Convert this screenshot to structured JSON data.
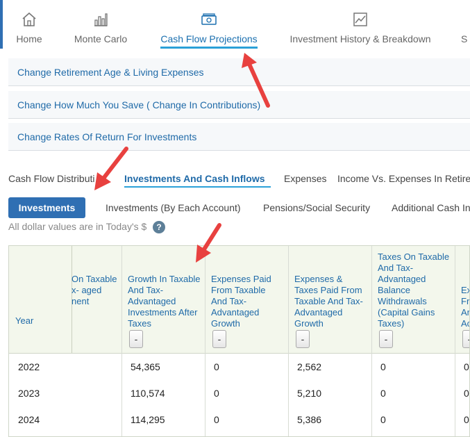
{
  "nav": {
    "items": [
      {
        "label": "Home",
        "icon": "home-icon"
      },
      {
        "label": "Monte Carlo",
        "icon": "bar-chart-icon"
      },
      {
        "label": "Cash Flow Projections",
        "icon": "cash-icon",
        "active": true
      },
      {
        "label": "Investment History & Breakdown",
        "icon": "line-chart-icon"
      },
      {
        "label": "S"
      }
    ]
  },
  "accordions": [
    "Change Retirement Age & Living Expenses",
    "Change How Much You Save ( Change In Contributions)",
    "Change Rates Of Return For Investments"
  ],
  "tabs": [
    "Cash Flow Distributi",
    "Investments And Cash Inflows",
    "Expenses",
    "Income Vs. Expenses In Retire"
  ],
  "pills": [
    "Investments",
    "Investments (By Each Account)",
    "Pensions/Social Security",
    "Additional Cash In"
  ],
  "note": "All dollar values are in Today's $",
  "help_icon": "?",
  "table": {
    "headers": {
      "year": "Year",
      "col1": "On Taxable x- aged nent",
      "col2": "Growth In Taxable And Tax-Advantaged Investments After Taxes",
      "col3": "Expenses Paid From Taxable And Tax-Advantaged Growth",
      "col4": "Expenses & Taxes Paid From Taxable And Tax-Advantaged Growth",
      "col5": "Taxes On Taxable And Tax-Advantaged Balance Withdrawals (Capital Gains Taxes)",
      "col6": "Ex Fr Ar Ac"
    },
    "collapse_label": "-",
    "rows": [
      {
        "year": "2022",
        "c2": "54,365",
        "c3": "0",
        "c4": "2,562",
        "c5": "0",
        "c6": "0"
      },
      {
        "year": "2023",
        "c2": "110,574",
        "c3": "0",
        "c4": "5,210",
        "c5": "0",
        "c6": "0"
      },
      {
        "year": "2024",
        "c2": "114,295",
        "c3": "0",
        "c4": "5,386",
        "c5": "0",
        "c6": "0"
      }
    ]
  },
  "colors": {
    "accent": "#2f6fb3",
    "link": "#1f6aa8",
    "annotation_arrow": "#e8413f"
  }
}
